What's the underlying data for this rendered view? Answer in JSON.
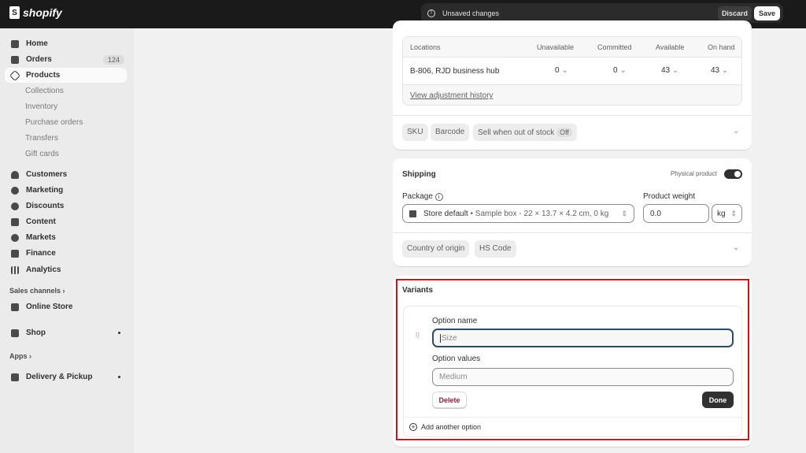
{
  "brand": "shopify",
  "topbar": {
    "status": "Unsaved changes",
    "discard": "Discard",
    "save": "Save"
  },
  "sidebar": {
    "home": "Home",
    "orders": "Orders",
    "orders_count": "124",
    "products": "Products",
    "sub": [
      "Collections",
      "Inventory",
      "Purchase orders",
      "Transfers",
      "Gift cards"
    ],
    "customers": "Customers",
    "marketing": "Marketing",
    "discounts": "Discounts",
    "content": "Content",
    "markets": "Markets",
    "finance": "Finance",
    "analytics": "Analytics",
    "sales_channels": "Sales channels ›",
    "online_store": "Online Store",
    "shop": "Shop",
    "apps": "Apps ›",
    "delivery": "Delivery & Pickup"
  },
  "inventory": {
    "columns": [
      "Locations",
      "Unavailable",
      "Committed",
      "Available",
      "On hand"
    ],
    "row": {
      "location": "B-806, RJD business hub",
      "unavailable": "0",
      "committed": "0",
      "available": "43",
      "on_hand": "43"
    },
    "history_link": "View adjustment history",
    "chips": {
      "sku": "SKU",
      "barcode": "Barcode",
      "sell_oos": "Sell when out of stock",
      "sell_oos_state": "Off"
    }
  },
  "shipping": {
    "title": "Shipping",
    "physical_label": "Physical product",
    "physical_on": true,
    "package_label": "Package",
    "package_value": "Store default",
    "package_detail": "• Sample box - 22 × 13.7 × 4.2 cm, 0 kg",
    "weight_label": "Product weight",
    "weight_value": "0.0",
    "weight_unit": "kg",
    "chips": {
      "country": "Country of origin",
      "hs": "HS Code"
    }
  },
  "variants": {
    "title": "Variants",
    "option_name_label": "Option name",
    "option_name_placeholder": "Size",
    "option_values_label": "Option values",
    "option_values_placeholder": "Medium",
    "delete": "Delete",
    "done": "Done",
    "add_option": "Add another option"
  },
  "colors": {
    "highlight": "#d6101a",
    "topbar": "#1a1a1a"
  }
}
